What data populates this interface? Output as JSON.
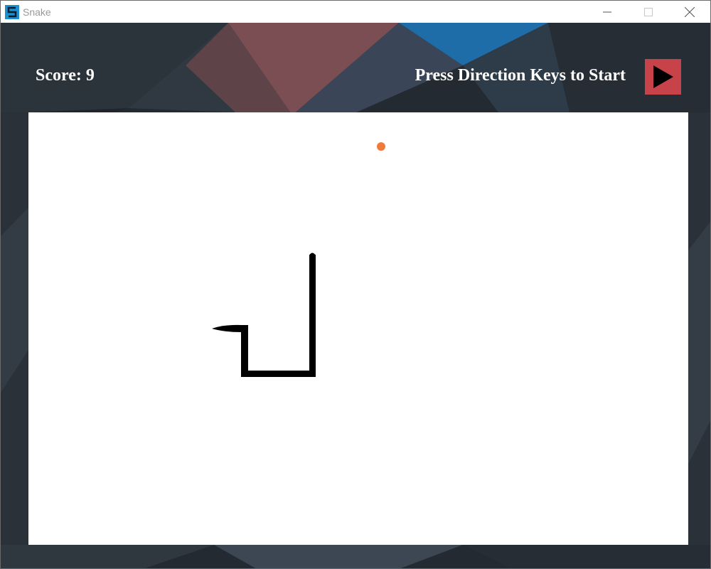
{
  "window": {
    "title": "Snake",
    "icon": "snake-app-icon",
    "controls": [
      "minimize-icon",
      "maximize-icon",
      "close-icon"
    ]
  },
  "hud": {
    "score_text": "Score: 9",
    "prompt_text": "Press Direction Keys to Start",
    "play_icon": "play-icon"
  },
  "board": {
    "background": "#ffffff",
    "snake_color": "#000000",
    "food_color": "#f07a3a",
    "snake_segments": 4,
    "food_count": 1
  },
  "colors": {
    "play_button": "#c8424a",
    "hud_text": "#ffffff"
  }
}
